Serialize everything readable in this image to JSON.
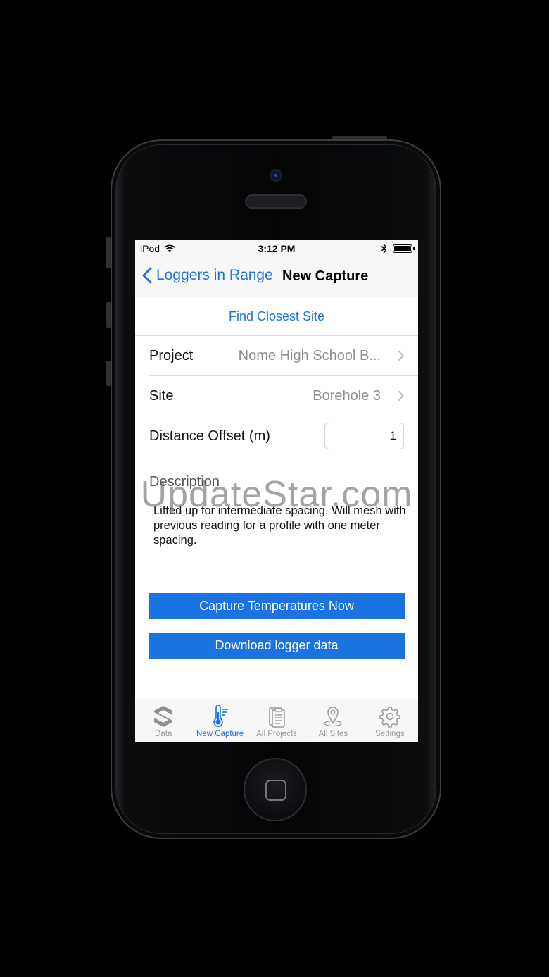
{
  "status_bar": {
    "carrier": "iPod",
    "time": "3:12 PM"
  },
  "nav": {
    "back_label": "Loggers in Range",
    "title": "New Capture"
  },
  "find_closest_label": "Find Closest Site",
  "form": {
    "project_label": "Project",
    "project_value": "Nome High School B...",
    "site_label": "Site",
    "site_value": "Borehole 3",
    "offset_label": "Distance Offset (m)",
    "offset_value": "1",
    "description_label": "Description",
    "description_text": "Lifted up for intermediate spacing. Will mesh with previous reading for a profile with one meter spacing."
  },
  "watermark": "UpdateStar.com",
  "buttons": {
    "capture": "Capture Temperatures Now",
    "download": "Download logger data"
  },
  "tabs": [
    {
      "label": "Data",
      "icon": "logo-s-icon"
    },
    {
      "label": "New Capture",
      "icon": "thermometer-icon",
      "active": true
    },
    {
      "label": "All Projects",
      "icon": "clipboard-icon"
    },
    {
      "label": "All Sites",
      "icon": "location-pin-icon"
    },
    {
      "label": "Settings",
      "icon": "gear-icon"
    }
  ],
  "colors": {
    "accent": "#1a73e0",
    "inactive": "#9a9a9f"
  }
}
